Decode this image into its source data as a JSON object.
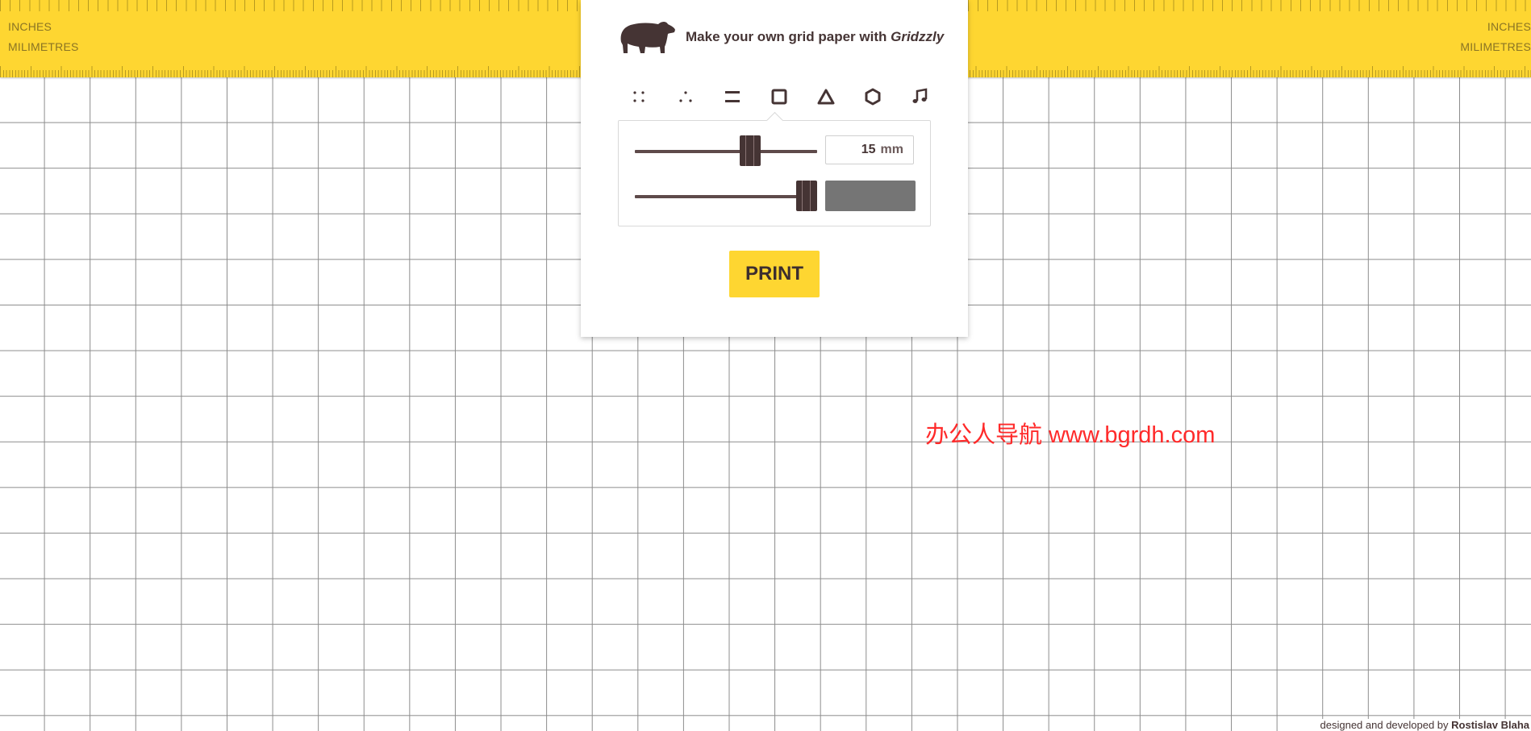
{
  "ruler": {
    "inches_label_left": "INCHES",
    "millimetres_label_left": "MILIMETRES",
    "inches_label_right": "INCHES",
    "millimetres_label_right": "MILIMETRES"
  },
  "header": {
    "tagline_prefix": "Make your own grid paper with",
    "app_name": "Gridzzly",
    "logo_icon": "bear-icon"
  },
  "grid_types": [
    {
      "name": "dots-square",
      "icon": "dots-square-icon",
      "selected": false
    },
    {
      "name": "dots-triangle",
      "icon": "dots-triangle-icon",
      "selected": false
    },
    {
      "name": "lines",
      "icon": "lines-icon",
      "selected": false
    },
    {
      "name": "squares",
      "icon": "square-icon",
      "selected": true
    },
    {
      "name": "triangles",
      "icon": "triangle-icon",
      "selected": false
    },
    {
      "name": "hexagons",
      "icon": "hexagon-icon",
      "selected": false
    },
    {
      "name": "music",
      "icon": "music-note-icon",
      "selected": false
    }
  ],
  "settings": {
    "size_value": "15",
    "size_unit": "mm",
    "size_slider_level": 0.65,
    "color_slider_level": 1.0,
    "line_color": "#757575"
  },
  "print_label": "PRINT",
  "watermark": "办公人导航  www.bgrdh.com",
  "credits": {
    "prefix": "designed and developed by",
    "author": "Rostislav Blaha"
  },
  "colors": {
    "accent": "#fed631",
    "brand_dark": "#453434",
    "grid_line": "#8c8c8c"
  }
}
